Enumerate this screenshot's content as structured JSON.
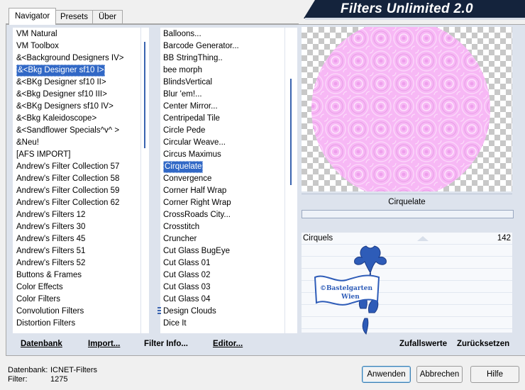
{
  "tabs": [
    {
      "label": "Navigator",
      "active": true
    },
    {
      "label": "Presets",
      "active": false
    },
    {
      "label": "Über",
      "active": false
    }
  ],
  "header": {
    "title": "Filters Unlimited 2.0"
  },
  "categories": {
    "items": [
      "VM Natural",
      "VM Toolbox",
      "&<Background Designers IV>",
      "&<Bkg Designer sf10 I>",
      "&<BKg Designer sf10 II>",
      "&<Bkg Designer sf10 III>",
      "&<BKg Designers sf10 IV>",
      "&<Bkg Kaleidoscope>",
      "&<Sandflower Specials^v^ >",
      "&Neu!",
      "[AFS IMPORT]",
      "Andrew's Filter Collection 57",
      "Andrew's Filter Collection 58",
      "Andrew's Filter Collection 59",
      "Andrew's Filter Collection 62",
      "Andrew's Filters 12",
      "Andrew's Filters 30",
      "Andrew's Filters 45",
      "Andrew's Filters 51",
      "Andrew's Filters 52",
      "Buttons & Frames",
      "Color Effects",
      "Color Filters",
      "Convolution Filters",
      "Distortion Filters"
    ],
    "selected_index": 3
  },
  "filters": {
    "items": [
      "Balloons...",
      "Barcode Generator...",
      "BB StringThing..",
      "bee morph",
      "BlindsVertical",
      "Blur 'em!...",
      "Center Mirror...",
      "Centripedal Tile",
      "Circle Pede",
      "Circular Weave...",
      "Circus Maximus",
      "Cirquelate",
      "Convergence",
      "Corner Half Wrap",
      "Corner Right Wrap",
      "CrossRoads City...",
      "Crosstitch",
      "Cruncher",
      "Cut Glass  BugEye",
      "Cut Glass 01",
      "Cut Glass 02",
      "Cut Glass 03",
      "Cut Glass 04",
      "Design Clouds",
      "Dice It"
    ],
    "selected_index": 11
  },
  "preview": {
    "filter_name": "Cirquelate",
    "accent_color": "#f7b8f5"
  },
  "params": [
    {
      "label": "Cirquels",
      "value": "142"
    }
  ],
  "watermark": {
    "text_line1": "©Bastelgarten",
    "text_line2": "Wien"
  },
  "bottom_links": {
    "database": "Datenbank",
    "import": "Import...",
    "filter_info": "Filter Info...",
    "editor": "Editor...",
    "random": "Zufallswerte",
    "reset": "Zurücksetzen"
  },
  "status": {
    "db_label": "Datenbank:",
    "db_value": "ICNET-Filters",
    "filter_label": "Filter:",
    "filter_value": "1275"
  },
  "buttons": {
    "apply": "Anwenden",
    "cancel": "Abbrechen",
    "help": "Hilfe"
  },
  "colors": {
    "selection": "#3168c6",
    "header_bg": "#14233c",
    "panel_bg": "#dde3ed"
  }
}
